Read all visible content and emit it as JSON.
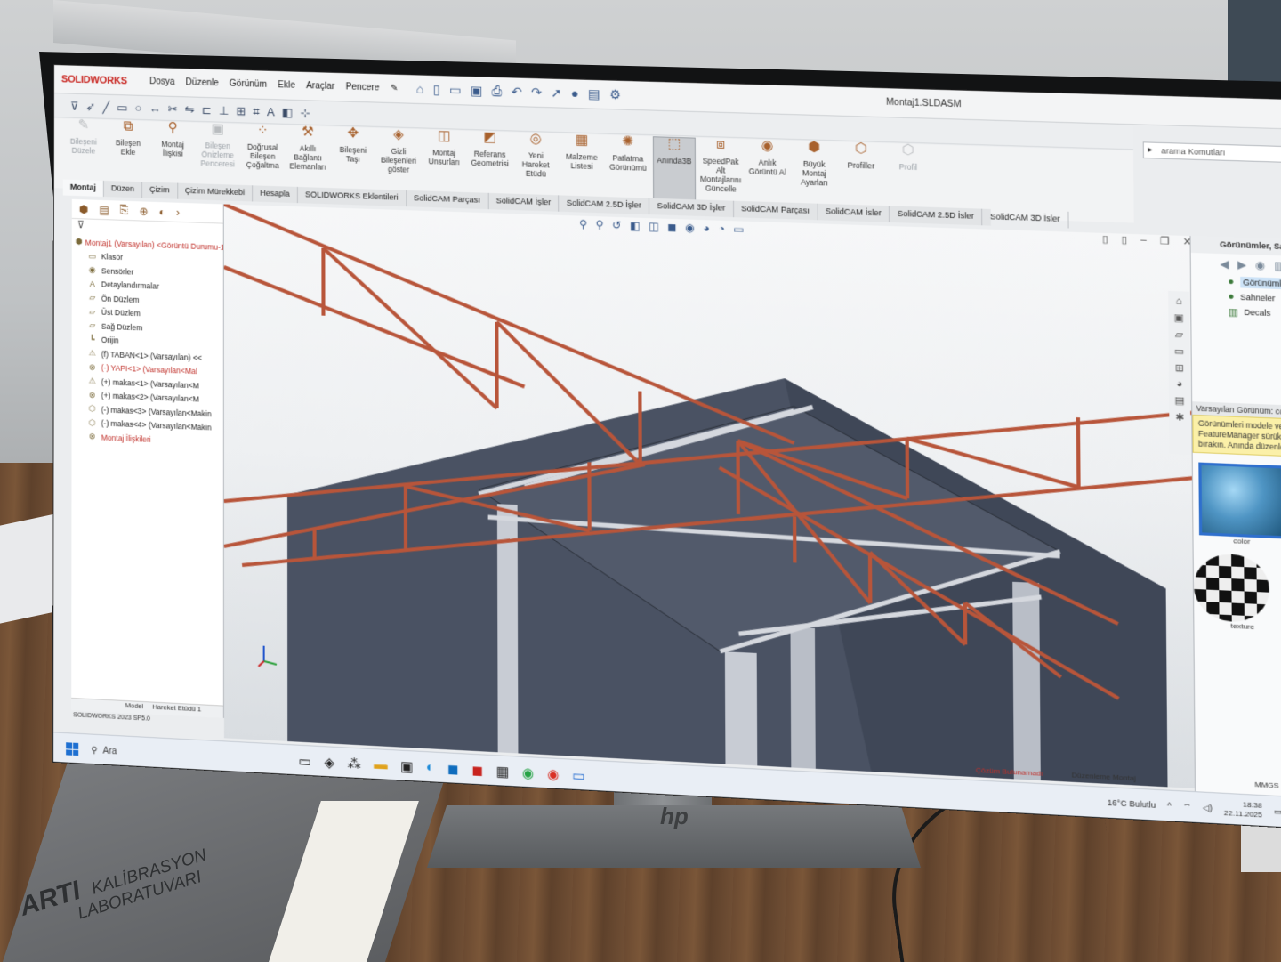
{
  "app": {
    "logo": "SOLIDWORKS",
    "menu": [
      "Dosya",
      "Düzenle",
      "Görünüm",
      "Ekle",
      "Araçlar",
      "Pencere"
    ],
    "document_title": "Montaj1.SLDASM",
    "search_placeholder": "arama Komutları"
  },
  "command_manager": [
    {
      "label": "Bileşeni Düzele",
      "icon": "edit-component-icon",
      "disabled": true
    },
    {
      "label": "Bileşen Ekle",
      "icon": "insert-component-icon",
      "disabled": false
    },
    {
      "label": "Montaj İlişkisi",
      "icon": "mate-icon",
      "disabled": false
    },
    {
      "label": "Bileşen Önizleme Penceresi",
      "icon": "preview-icon",
      "disabled": true
    },
    {
      "label": "Doğrusal Bileşen Çoğaltma",
      "icon": "pattern-icon",
      "disabled": false
    },
    {
      "label": "Akıllı Bağlantı Elemanları",
      "icon": "fastener-icon",
      "disabled": false
    },
    {
      "label": "Bileşeni Taşı",
      "icon": "move-icon",
      "disabled": false
    },
    {
      "label": "Gizli Bileşenleri göster",
      "icon": "show-hidden-icon",
      "disabled": false
    },
    {
      "label": "Montaj Unsurları",
      "icon": "assembly-features-icon",
      "disabled": false
    },
    {
      "label": "Referans Geometrisi",
      "icon": "reference-geometry-icon",
      "disabled": false
    },
    {
      "label": "Yeni Hareket Etüdü",
      "icon": "motion-study-icon",
      "disabled": false
    },
    {
      "label": "Malzeme Listesi",
      "icon": "bom-icon",
      "disabled": false
    },
    {
      "label": "Patlatma Görünümü",
      "icon": "explode-icon",
      "disabled": false
    },
    {
      "label": "Anında3B",
      "icon": "instant3d-icon",
      "disabled": false,
      "active": true
    },
    {
      "label": "SpeedPak Alt Montajlarını Güncelle",
      "icon": "speedpak-icon",
      "disabled": false
    },
    {
      "label": "Anlık Görüntü Al",
      "icon": "snapshot-icon",
      "disabled": false
    },
    {
      "label": "Büyük Montaj Ayarları",
      "icon": "large-assembly-icon",
      "disabled": false
    },
    {
      "label": "Profiller",
      "icon": "profiles-icon",
      "disabled": false
    },
    {
      "label": "Profil",
      "icon": "profile-icon",
      "disabled": true
    }
  ],
  "tabs": [
    "Montaj",
    "Düzen",
    "Çizim",
    "Çizim Mürekkebi",
    "Hesapla",
    "SOLIDWORKS Eklentileri",
    "SolidCAM Parçası",
    "SolidCAM İşler",
    "SolidCAM 2.5D İşler",
    "SolidCAM 3D İşler",
    "SolidCAM Parçası",
    "SolidCAM İsler",
    "SolidCAM 2.5D İsler",
    "SolidCAM 3D İsler"
  ],
  "feature_tree": [
    {
      "label": "Montaj1 (Varsayılan) <Görüntü Durumu-1>",
      "icon": "assembly-icon",
      "kind": "root"
    },
    {
      "label": "Klasör",
      "icon": "folder-icon",
      "kind": ""
    },
    {
      "label": "Sensörler",
      "icon": "sensor-icon",
      "kind": ""
    },
    {
      "label": "Detaylandırmalar",
      "icon": "annotation-icon",
      "kind": ""
    },
    {
      "label": "Ön Düzlem",
      "icon": "plane-icon",
      "kind": ""
    },
    {
      "label": "Üst Düzlem",
      "icon": "plane-icon",
      "kind": ""
    },
    {
      "label": "Sağ Düzlem",
      "icon": "plane-icon",
      "kind": ""
    },
    {
      "label": "Orijin",
      "icon": "origin-icon",
      "kind": ""
    },
    {
      "label": "(f) TABAN<1> (Varsayılan) <<",
      "icon": "part-warning-icon",
      "kind": ""
    },
    {
      "label": "(-) YAPI<1> (Varsayılan<Mal",
      "icon": "part-error-icon",
      "kind": "err"
    },
    {
      "label": "(+) makas<1> (Varsayılan<M",
      "icon": "part-warning-icon",
      "kind": ""
    },
    {
      "label": "(+) makas<2> (Varsayılan<M",
      "icon": "part-error-icon",
      "kind": ""
    },
    {
      "label": "(-) makas<3> (Varsayılan<Makin",
      "icon": "part-icon",
      "kind": ""
    },
    {
      "label": "(-) makas<4> (Varsayılan<Makin",
      "icon": "part-icon",
      "kind": ""
    },
    {
      "label": "Montaj İlişkileri",
      "icon": "mates-error-icon",
      "kind": "err"
    }
  ],
  "bottom_tabs": [
    "Model",
    "Hareket Etüdü 1"
  ],
  "status_version": "SOLIDWORKS 2023 SP5.0",
  "task_pane": {
    "header": "Görünümler, Sahneler ve Yapıştırmalar",
    "items": [
      {
        "label": "Görünümler(color)",
        "selected": true
      },
      {
        "label": "Sahneler",
        "selected": false
      },
      {
        "label": "Decals",
        "selected": false
      }
    ],
    "desc_title": "Varsayılan Görünüm: color",
    "desc_text": "Görünümleri modele veya FeatureManager sürükleyin ve bırakın. Anında düzenleme yapın",
    "swatch_color_label": "color",
    "swatch_texture_label": "texture"
  },
  "status_bar": {
    "error": "Çözüm Bulunamadı",
    "mode": "Düzenleme Montaj",
    "units": "MMGS"
  },
  "taskbar": {
    "search": "Ara",
    "weather": "16°C Bulutlu",
    "time": "18:38",
    "date": "22.11.2025"
  },
  "room": {
    "notebook_brand": "ARTI",
    "notebook_line1": "KALİBRASYON",
    "notebook_line2": "LABORATUVARI"
  }
}
